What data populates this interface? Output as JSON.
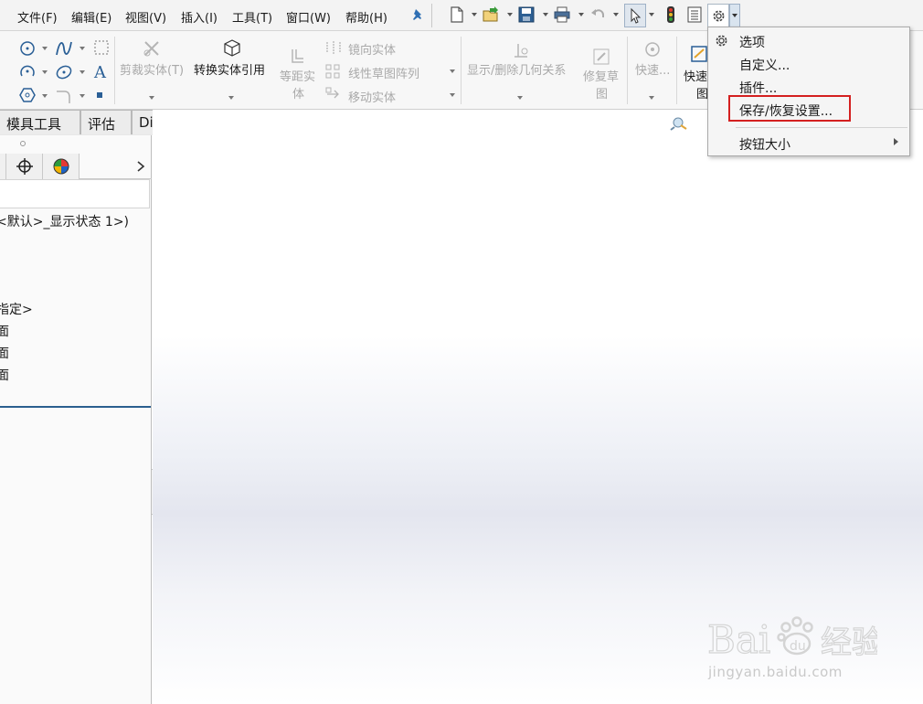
{
  "menubar": {
    "items": [
      "文件(F)",
      "编辑(E)",
      "视图(V)",
      "插入(I)",
      "工具(T)",
      "窗口(W)",
      "帮助(H)"
    ]
  },
  "commands": {
    "trim": "剪裁实体(T)",
    "convert": "转换实体引用",
    "offset_line1": "等距实",
    "offset_line2": "体",
    "mirror": "镜向实体",
    "linear_pattern": "线性草图阵列",
    "move": "移动实体",
    "relations": "显示/删除几何关系",
    "repair_line1": "修复草",
    "repair_line2": "图",
    "quick_snaps": "快速...",
    "quick_view_line1": "快速",
    "quick_view_line2": "图"
  },
  "tabs": [
    "模具工具",
    "评估",
    "DimXpert"
  ],
  "tree": {
    "display_state": "<默认>_显示状态 1>)",
    "unspecified": "指定>",
    "plane1": "面",
    "plane2": "面",
    "plane3": "面"
  },
  "dropdown": {
    "items": [
      "选项",
      "自定义...",
      "插件...",
      "保存/恢复设置...",
      "按钮大小"
    ],
    "highlight_color": "#d42020"
  },
  "watermark": {
    "url": "jingyan.baidu.com"
  }
}
